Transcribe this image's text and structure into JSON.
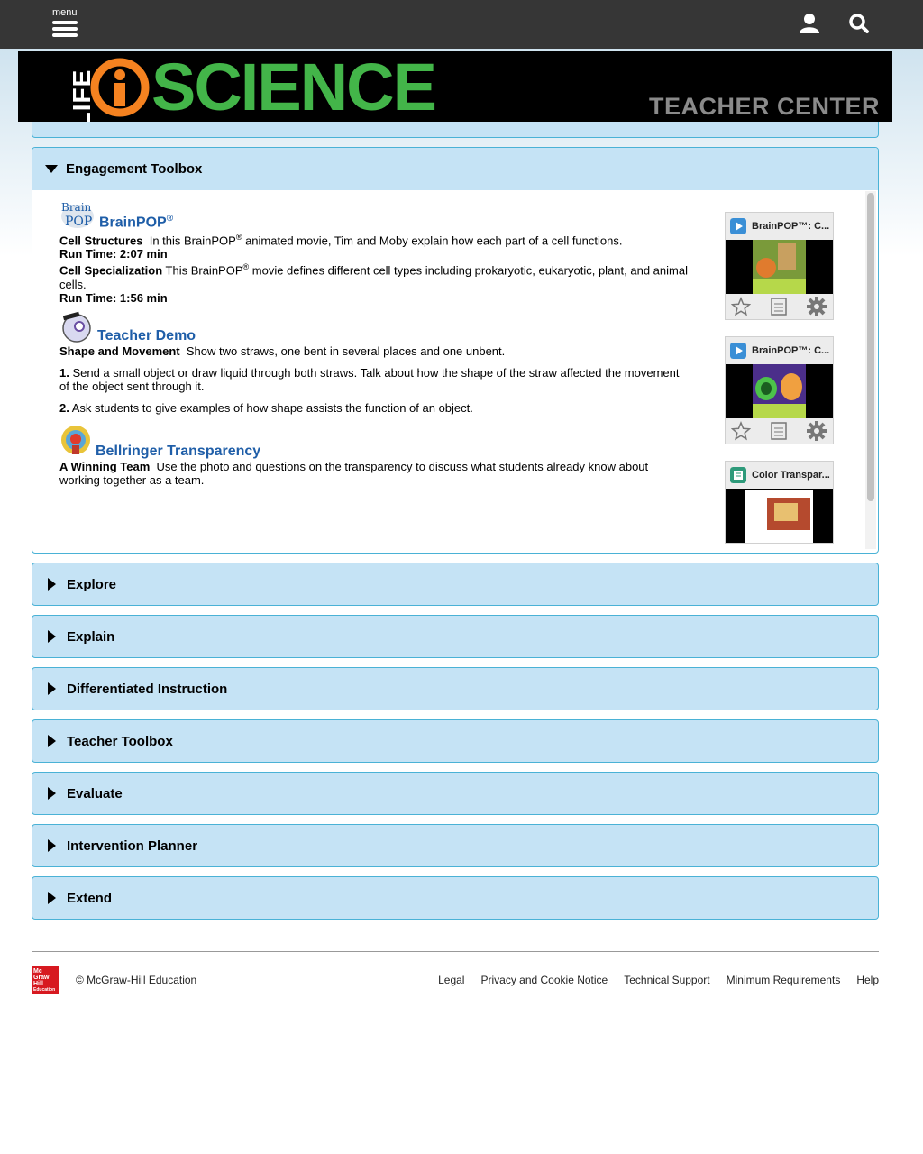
{
  "topbar": {
    "menu_label": "menu"
  },
  "banner": {
    "life": "LIFE",
    "science": "SCIENCE",
    "teacher_center": "TEACHER CENTER"
  },
  "panel": {
    "title": "Engagement Toolbox",
    "brainpop": {
      "title": "BrainPOP",
      "reg": "®",
      "logo_text_1": "Brain",
      "logo_text_2": "POP",
      "item1_label": "Cell Structures",
      "item1_text_a": "In this BrainPOP",
      "item1_text_reg": "®",
      "item1_text_b": " animated movie, Tim and Moby explain how each part of a cell functions.",
      "item1_runtime": "Run Time: 2:07 min",
      "item2_label": "Cell Specialization",
      "item2_text_a": " This BrainPOP",
      "item2_text_reg": "®",
      "item2_text_b": " movie defines different cell types including prokaryotic, eukaryotic, plant, and animal cells.",
      "item2_runtime": "Run Time: 1:56 min"
    },
    "demo": {
      "title": "Teacher Demo",
      "label": "Shape and Movement",
      "intro": "Show two straws, one bent in several places and one unbent.",
      "step1_num": "1.",
      "step1": " Send a small object or draw liquid through both straws. Talk about how the shape of the straw affected the movement of the object sent through it.",
      "step2_num": "2.",
      "step2": " Ask students to give examples of how shape assists the function of an object."
    },
    "bellringer": {
      "title": "Bellringer Transparency",
      "label": "A Winning Team",
      "text": "Use the photo and questions on the transparency to discuss what students already know about working together as a team."
    },
    "cards": [
      {
        "title": "BrainPOP™: C...",
        "icon": "play-icon"
      },
      {
        "title": "BrainPOP™: C...",
        "icon": "play-icon"
      },
      {
        "title": "Color Transpar...",
        "icon": "document-icon"
      }
    ]
  },
  "sections": [
    "Explore",
    "Explain",
    "Differentiated Instruction",
    "Teacher Toolbox",
    "Evaluate",
    "Intervention Planner",
    "Extend"
  ],
  "footer": {
    "logo_text": [
      "Mc",
      "Graw",
      "Hill",
      "Education"
    ],
    "copyright": "© McGraw-Hill Education",
    "links": [
      "Legal",
      "Privacy and Cookie Notice",
      "Technical Support",
      "Minimum Requirements",
      "Help"
    ]
  },
  "colors": {
    "accent_blue": "#1f5ea8",
    "panel_bg": "#c5e3f5",
    "panel_border": "#4ab2d6",
    "logo_green": "#43b549",
    "logo_orange": "#f58220"
  }
}
